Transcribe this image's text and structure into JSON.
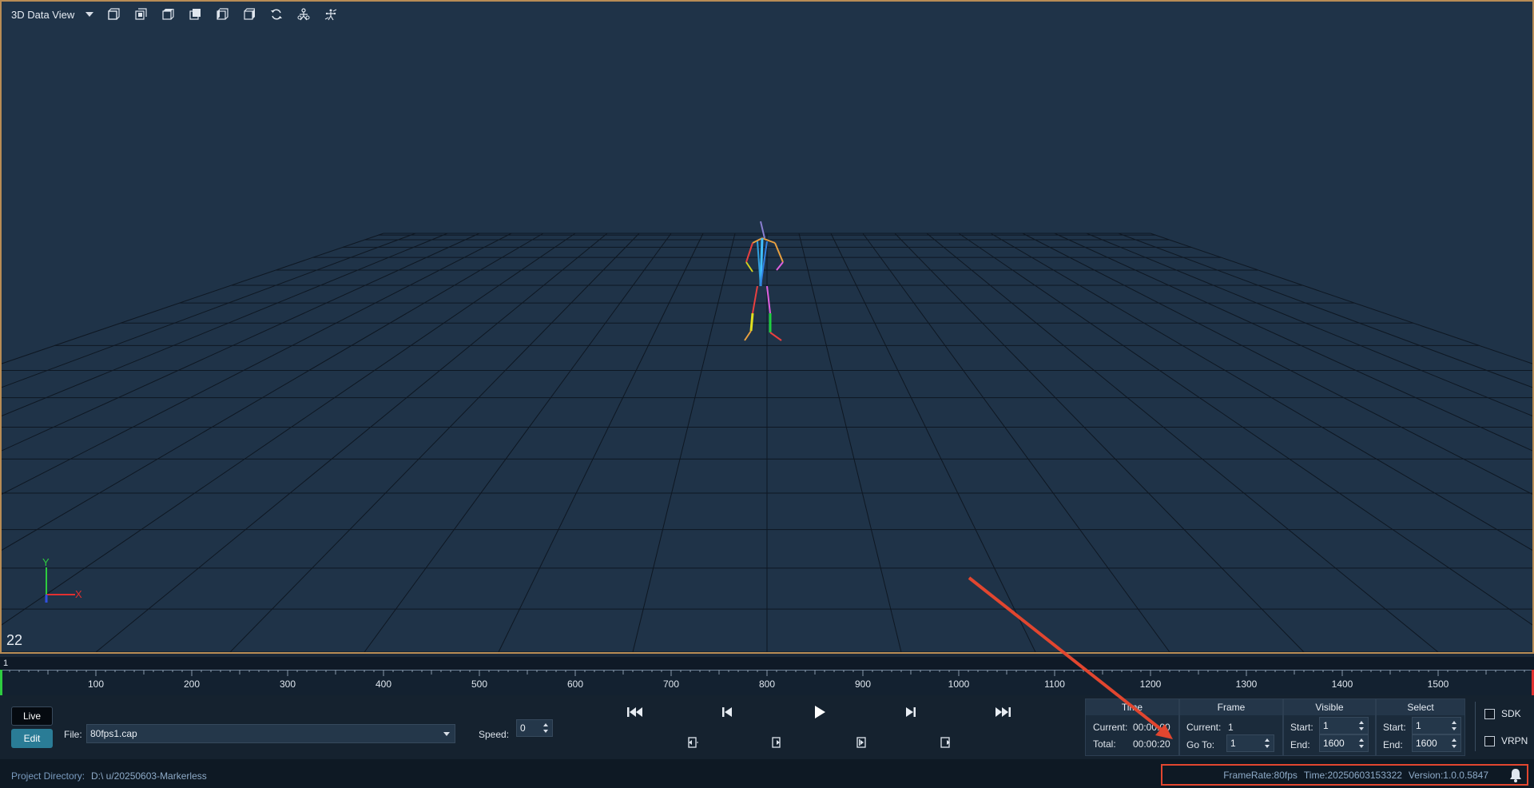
{
  "toolbar": {
    "view_title": "3D Data View",
    "icons": [
      "view-front-icon",
      "view-side-icon",
      "view-top-icon",
      "view-back-icon",
      "view-left-icon",
      "view-right-icon",
      "rotate-icon",
      "skeleton-icon",
      "markers-icon"
    ]
  },
  "viewport": {
    "frame_counter": "22",
    "axis_y_label": "Y",
    "axis_x_label": "X",
    "colors": {
      "background": "#1f3348",
      "grid": "#0e1722",
      "border": "#b88c55"
    }
  },
  "timeline": {
    "start_label": "1",
    "ticks": [
      "100",
      "200",
      "300",
      "400",
      "500",
      "600",
      "700",
      "800",
      "900",
      "1000",
      "1100",
      "1200",
      "1300",
      "1400",
      "1500"
    ]
  },
  "controls": {
    "live_label": "Live",
    "edit_label": "Edit",
    "file_label": "File:",
    "file_value": "80fps1.cap",
    "speed_label": "Speed:",
    "speed_value": "0"
  },
  "time_panel": {
    "title": "Time",
    "current_label": "Current:",
    "current_value": "00:00:00",
    "total_label": "Total:",
    "total_value": "00:00:20"
  },
  "frame_panel": {
    "title": "Frame",
    "current_label": "Current:",
    "current_value": "1",
    "goto_label": "Go To:",
    "goto_value": "1"
  },
  "visible_panel": {
    "title": "Visible",
    "start_label": "Start:",
    "start_value": "1",
    "end_label": "End:",
    "end_value": "1600"
  },
  "select_panel": {
    "title": "Select",
    "start_label": "Start:",
    "start_value": "1",
    "end_label": "End:",
    "end_value": "1600"
  },
  "outputs": {
    "sdk_label": "SDK",
    "vrpn_label": "VRPN"
  },
  "statusbar": {
    "project_label": "Project Directory:",
    "project_value": "D:\\            u/20250603-Markerless",
    "framerate": "FrameRate:80fps",
    "time": "Time:20250603153322",
    "version": "Version:1.0.0.5847"
  },
  "annotation": {
    "color": "#e2462f"
  }
}
